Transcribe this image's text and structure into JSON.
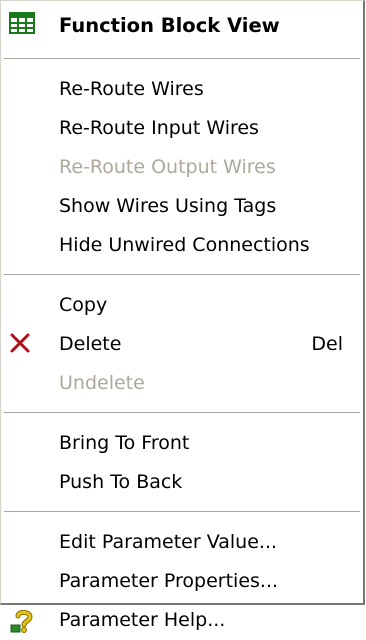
{
  "menu": {
    "header": {
      "label": "Function Block View",
      "icon": "grid-table-icon"
    },
    "wires": [
      {
        "label": "Re-Route Wires",
        "enabled": true
      },
      {
        "label": "Re-Route Input Wires",
        "enabled": true
      },
      {
        "label": "Re-Route Output Wires",
        "enabled": false
      },
      {
        "label": "Show Wires Using Tags",
        "enabled": true
      },
      {
        "label": "Hide Unwired Connections",
        "enabled": true
      }
    ],
    "edit": [
      {
        "label": "Copy",
        "enabled": true
      },
      {
        "label": "Delete",
        "enabled": true,
        "shortcut": "Del",
        "icon": "delete-x-icon"
      },
      {
        "label": "Undelete",
        "enabled": false
      }
    ],
    "order": [
      {
        "label": "Bring To Front",
        "enabled": true
      },
      {
        "label": "Push To Back",
        "enabled": true
      }
    ],
    "params": [
      {
        "label": "Edit Parameter Value...",
        "enabled": true
      },
      {
        "label": "Parameter Properties...",
        "enabled": true
      },
      {
        "label": "Parameter Help...",
        "enabled": true,
        "icon": "help-question-icon"
      }
    ]
  },
  "colors": {
    "disabled_text": "#ada899",
    "delete_icon": "#b0101a",
    "grid_icon": "#1a7a1a",
    "help_icon": "#e3c21a"
  }
}
